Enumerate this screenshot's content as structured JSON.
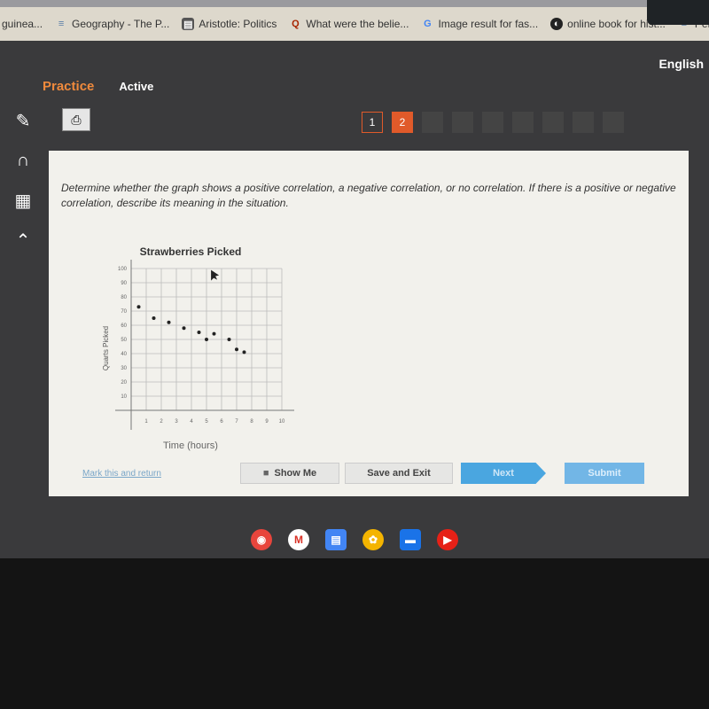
{
  "bookmarks": [
    {
      "label": "guinea...",
      "icon": "none"
    },
    {
      "label": "Geography - The P...",
      "icon": "site-icon"
    },
    {
      "label": "Aristotle: Politics",
      "icon": "book-icon"
    },
    {
      "label": "What were the belie...",
      "icon": "quora-icon"
    },
    {
      "label": "Image result for fas...",
      "icon": "google-icon"
    },
    {
      "label": "online book for hist...",
      "icon": "globe-icon"
    },
    {
      "label": "Persia",
      "icon": "site-icon"
    }
  ],
  "header": {
    "language": "English",
    "tabs": [
      "Practice",
      "Active"
    ]
  },
  "pages": [
    "1",
    "2"
  ],
  "colors": {
    "accent": "#e05a2a",
    "next": "#4aa6e0",
    "card": "#f2f1ec"
  },
  "question": "Determine whether the graph shows a positive correlation, a negative correlation, or no correlation. If there is a positive or negative correlation, describe its meaning in the situation.",
  "buttons": {
    "mark": "Mark this and return",
    "show": "Show Me",
    "save": "Save and Exit",
    "next": "Next",
    "submit": "Submit"
  },
  "chart_data": {
    "type": "scatter",
    "title": "Strawberries Picked",
    "xlabel": "Time (hours)",
    "ylabel": "Quarts Picked",
    "xlim": [
      0,
      10
    ],
    "ylim": [
      0,
      100
    ],
    "xticks": [
      "1",
      "2",
      "3",
      "4",
      "5",
      "6",
      "7",
      "8",
      "9",
      "10"
    ],
    "yticks": [
      "10",
      "20",
      "30",
      "40",
      "50",
      "60",
      "70",
      "80",
      "90",
      "100"
    ],
    "grid": true,
    "points": [
      [
        0.5,
        73
      ],
      [
        1.5,
        65
      ],
      [
        2.5,
        62
      ],
      [
        3.5,
        58
      ],
      [
        4.5,
        55
      ],
      [
        5,
        50
      ],
      [
        5.5,
        54
      ],
      [
        6.5,
        50
      ],
      [
        7,
        43
      ],
      [
        7.5,
        41
      ]
    ]
  }
}
